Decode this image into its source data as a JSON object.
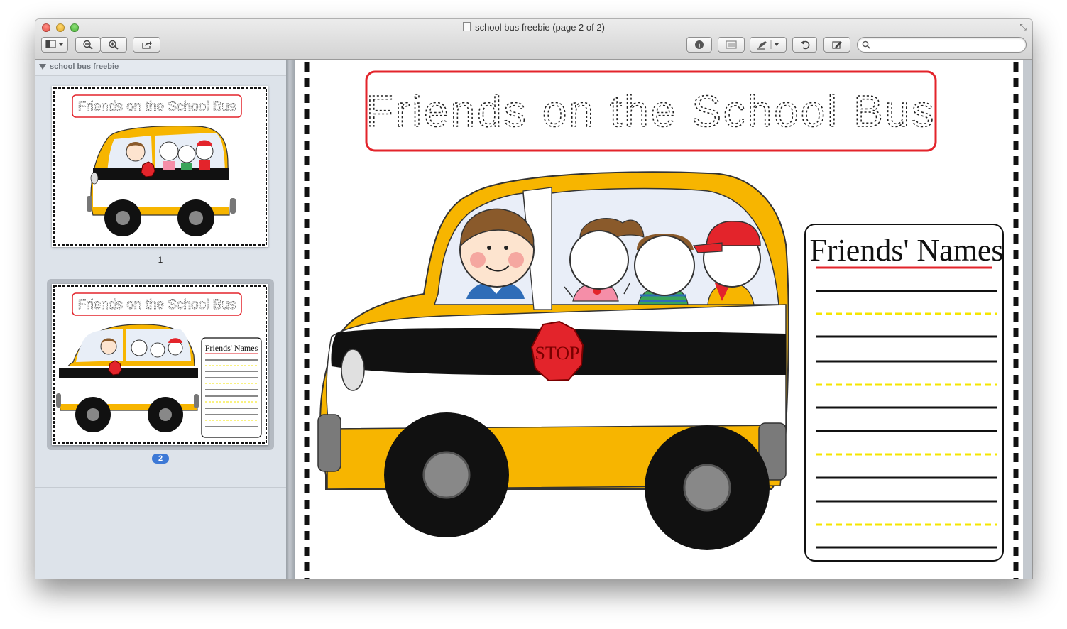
{
  "window": {
    "title": "school bus freebie (page 2 of 2)"
  },
  "toolbar": {
    "search": {
      "placeholder": "",
      "value": ""
    }
  },
  "sidebar": {
    "section_title": "school bus freebie",
    "pages": [
      {
        "label": "1",
        "selected": false
      },
      {
        "label": "2",
        "selected": true
      }
    ]
  },
  "worksheet": {
    "title": "Friends on the School Bus",
    "names_box_title": "Friends' Names",
    "stop_sign": "STOP"
  },
  "colors": {
    "accent_red": "#e3242b",
    "bus_yellow": "#f7b500",
    "dashed_yellow": "#f5e600",
    "selection_blue": "#3d79d6"
  }
}
